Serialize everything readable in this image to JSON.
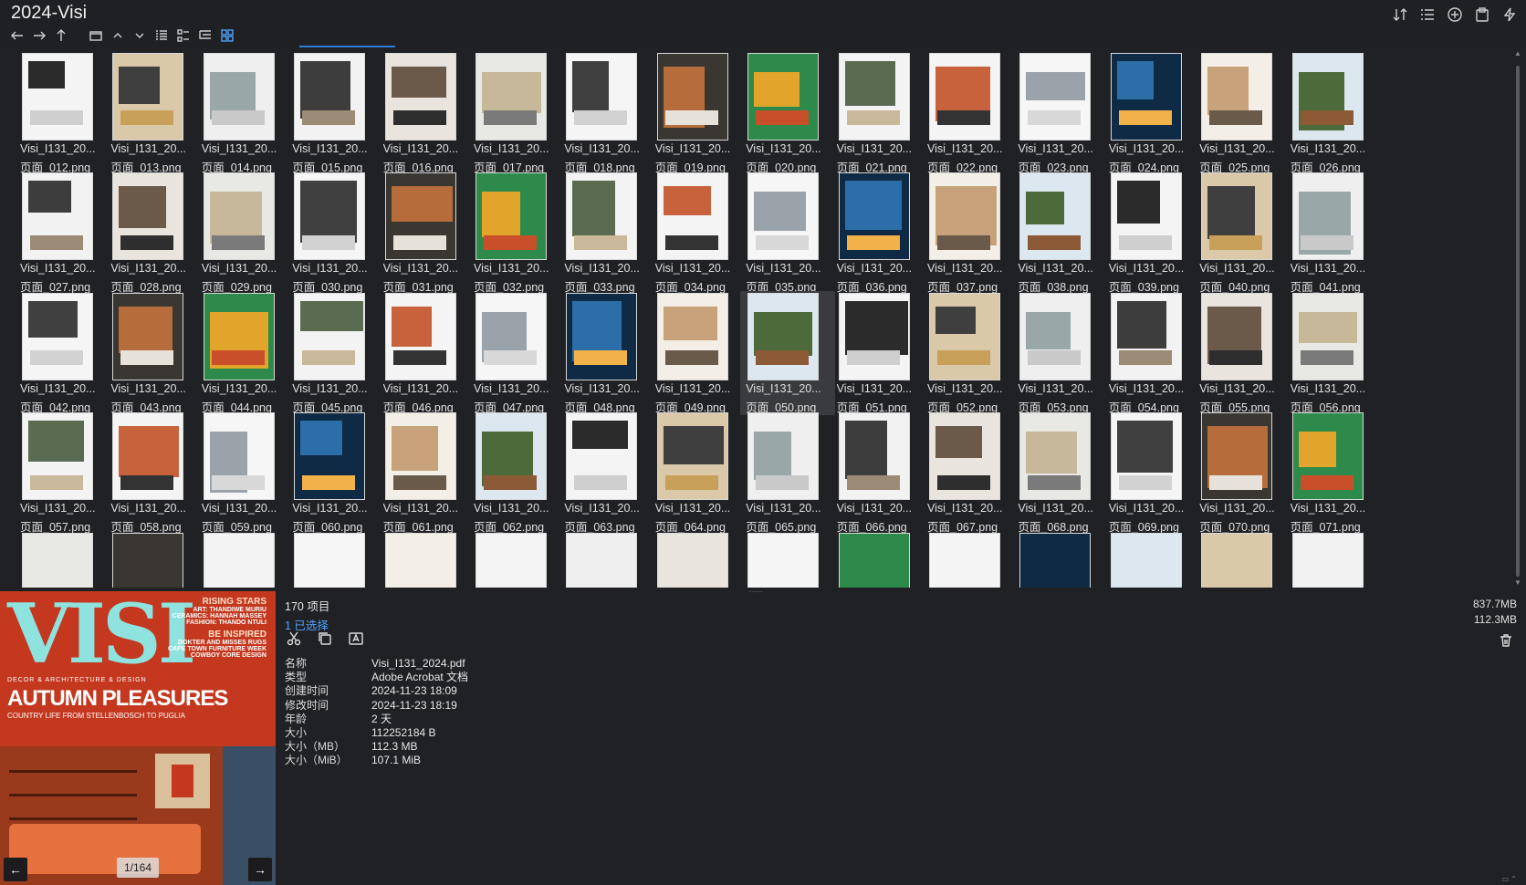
{
  "window": {
    "title": "2024-Visi"
  },
  "toolbar": {
    "right_icons": [
      "sort-icon",
      "list-view-icon",
      "add-circle-icon",
      "clipboard-icon",
      "flash-icon"
    ],
    "nav_icons": [
      "back-arrow-icon",
      "forward-arrow-icon",
      "up-arrow-icon",
      "folder-icon",
      "chevron-up-icon",
      "chevron-down-icon",
      "details-view-icon",
      "list-view-icon",
      "tree-view-icon",
      "thumbnail-view-icon"
    ]
  },
  "grid": {
    "rows": [
      [
        {
          "l1": "Visi_I131_20...",
          "l2": "页面_012.png"
        },
        {
          "l1": "Visi_I131_20...",
          "l2": "页面_013.png"
        },
        {
          "l1": "Visi_I131_20...",
          "l2": "页面_014.png"
        },
        {
          "l1": "Visi_I131_20...",
          "l2": "页面_015.png"
        },
        {
          "l1": "Visi_I131_20...",
          "l2": "页面_016.png"
        },
        {
          "l1": "Visi_I131_20...",
          "l2": "页面_017.png"
        },
        {
          "l1": "Visi_I131_20...",
          "l2": "页面_018.png"
        },
        {
          "l1": "Visi_I131_20...",
          "l2": "页面_019.png"
        },
        {
          "l1": "Visi_I131_20...",
          "l2": "页面_020.png"
        },
        {
          "l1": "Visi_I131_20...",
          "l2": "页面_021.png"
        },
        {
          "l1": "Visi_I131_20...",
          "l2": "页面_022.png"
        },
        {
          "l1": "Visi_I131_20...",
          "l2": "页面_023.png"
        },
        {
          "l1": "Visi_I131_20...",
          "l2": "页面_024.png"
        },
        {
          "l1": "Visi_I131_20...",
          "l2": "页面_025.png"
        },
        {
          "l1": "Visi_I131_20...",
          "l2": "页面_026.png"
        }
      ],
      [
        {
          "l1": "Visi_I131_20...",
          "l2": "页面_027.png"
        },
        {
          "l1": "Visi_I131_20...",
          "l2": "页面_028.png"
        },
        {
          "l1": "Visi_I131_20...",
          "l2": "页面_029.png"
        },
        {
          "l1": "Visi_I131_20...",
          "l2": "页面_030.png"
        },
        {
          "l1": "Visi_I131_20...",
          "l2": "页面_031.png"
        },
        {
          "l1": "Visi_I131_20...",
          "l2": "页面_032.png"
        },
        {
          "l1": "Visi_I131_20...",
          "l2": "页面_033.png"
        },
        {
          "l1": "Visi_I131_20...",
          "l2": "页面_034.png"
        },
        {
          "l1": "Visi_I131_20...",
          "l2": "页面_035.png"
        },
        {
          "l1": "Visi_I131_20...",
          "l2": "页面_036.png"
        },
        {
          "l1": "Visi_I131_20...",
          "l2": "页面_037.png"
        },
        {
          "l1": "Visi_I131_20...",
          "l2": "页面_038.png"
        },
        {
          "l1": "Visi_I131_20...",
          "l2": "页面_039.png"
        },
        {
          "l1": "Visi_I131_20...",
          "l2": "页面_040.png"
        },
        {
          "l1": "Visi_I131_20...",
          "l2": "页面_041.png"
        }
      ],
      [
        {
          "l1": "Visi_I131_20...",
          "l2": "页面_042.png"
        },
        {
          "l1": "Visi_I131_20...",
          "l2": "页面_043.png"
        },
        {
          "l1": "Visi_I131_20...",
          "l2": "页面_044.png"
        },
        {
          "l1": "Visi_I131_20...",
          "l2": "页面_045.png"
        },
        {
          "l1": "Visi_I131_20...",
          "l2": "页面_046.png"
        },
        {
          "l1": "Visi_I131_20...",
          "l2": "页面_047.png"
        },
        {
          "l1": "Visi_I131_20...",
          "l2": "页面_048.png"
        },
        {
          "l1": "Visi_I131_20...",
          "l2": "页面_049.png"
        },
        {
          "l1": "Visi_I131_20...",
          "l2": "页面_050.png",
          "selected": true
        },
        {
          "l1": "Visi_I131_20...",
          "l2": "页面_051.png"
        },
        {
          "l1": "Visi_I131_20...",
          "l2": "页面_052.png"
        },
        {
          "l1": "Visi_I131_20...",
          "l2": "页面_053.png"
        },
        {
          "l1": "Visi_I131_20...",
          "l2": "页面_054.png"
        },
        {
          "l1": "Visi_I131_20...",
          "l2": "页面_055.png"
        },
        {
          "l1": "Visi_I131_20...",
          "l2": "页面_056.png"
        }
      ],
      [
        {
          "l1": "Visi_I131_20...",
          "l2": "页面_057.png"
        },
        {
          "l1": "Visi_I131_20...",
          "l2": "页面_058.png"
        },
        {
          "l1": "Visi_I131_20...",
          "l2": "页面_059.png"
        },
        {
          "l1": "Visi_I131_20...",
          "l2": "页面_060.png"
        },
        {
          "l1": "Visi_I131_20...",
          "l2": "页面_061.png"
        },
        {
          "l1": "Visi_I131_20...",
          "l2": "页面_062.png"
        },
        {
          "l1": "Visi_I131_20...",
          "l2": "页面_063.png"
        },
        {
          "l1": "Visi_I131_20...",
          "l2": "页面_064.png"
        },
        {
          "l1": "Visi_I131_20...",
          "l2": "页面_065.png"
        },
        {
          "l1": "Visi_I131_20...",
          "l2": "页面_066.png"
        },
        {
          "l1": "Visi_I131_20...",
          "l2": "页面_067.png"
        },
        {
          "l1": "Visi_I131_20...",
          "l2": "页面_068.png"
        },
        {
          "l1": "Visi_I131_20...",
          "l2": "页面_069.png"
        },
        {
          "l1": "Visi_I131_20...",
          "l2": "页面_070.png"
        },
        {
          "l1": "Visi_I131_20...",
          "l2": "页面_071.png"
        }
      ]
    ],
    "partial_row_count": 15
  },
  "preview": {
    "cover": {
      "logo": "VISI",
      "subtitle": "DECOR & ARCHITECTURE & DESIGN",
      "headline": "AUTUMN PLEASURES",
      "tagline": "COUNTRY LIFE FROM STELLENBOSCH TO PUGLIA",
      "right_heading_1": "RISING STARS",
      "right_lines_1": [
        "ART: THANDIWE MURIU",
        "CERAMICS: HANNAH MASSEY",
        "FASHION: THANDO NTULI"
      ],
      "right_heading_2": "BE INSPIRED",
      "right_lines_2": [
        "DOKTER AND MISSES RUGS",
        "CAPE TOWN FURNITURE WEEK",
        "COWBOY CORE DESIGN"
      ]
    },
    "page_indicator": "1/164"
  },
  "info": {
    "item_count": "170 项目",
    "selected_count": "1 已选择",
    "size_total": "837.7MB",
    "size_selected": "112.3MB",
    "properties": [
      {
        "key": "名称",
        "value": "Visi_I131_2024.pdf"
      },
      {
        "key": "类型",
        "value": "Adobe Acrobat 文档"
      },
      {
        "key": "创建时间",
        "value": "2024-11-23  18:09"
      },
      {
        "key": "修改时间",
        "value": "2024-11-23  18:19"
      },
      {
        "key": "年龄",
        "value": "2 天"
      },
      {
        "key": "大小",
        "value": "112252184 B"
      },
      {
        "key": "大小（MB）",
        "value": "112.3 MB"
      },
      {
        "key": "大小（MiB）",
        "value": "107.1 MiB"
      }
    ]
  },
  "colors": {
    "background": "#202124",
    "accent": "#4ea3ff",
    "selection": "#3a3b3e"
  }
}
